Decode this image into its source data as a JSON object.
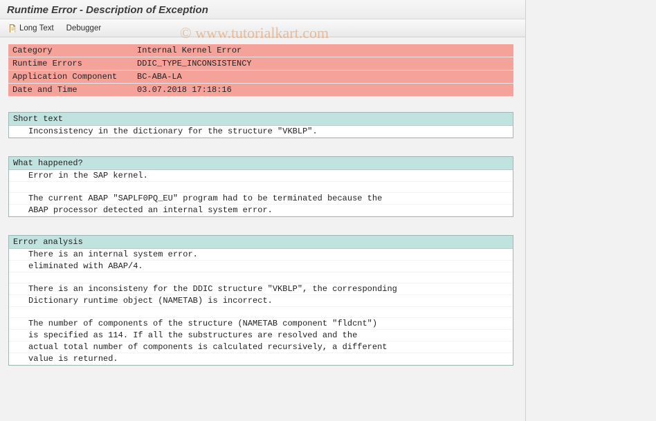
{
  "title": "Runtime Error - Description of Exception",
  "toolbar": {
    "long_text": "Long Text",
    "debugger": "Debugger"
  },
  "summary": [
    {
      "label": "Category",
      "value": "Internal Kernel Error"
    },
    {
      "label": "Runtime Errors",
      "value": "DDIC_TYPE_INCONSISTENCY"
    },
    {
      "label": "Application Component",
      "value": "BC-ABA-LA"
    },
    {
      "label": "Date and Time",
      "value": "03.07.2018 17:18:16"
    }
  ],
  "sections": {
    "short_text": {
      "header": "Short text",
      "lines": [
        "Inconsistency in the dictionary for the structure \"VKBLP\"."
      ]
    },
    "what_happened": {
      "header": "What happened?",
      "lines": [
        "Error in the SAP kernel.",
        "",
        "The current ABAP \"SAPLF0PQ_EU\" program had to be terminated because the",
        "ABAP processor detected an internal system error."
      ]
    },
    "error_analysis": {
      "header": "Error analysis",
      "lines": [
        "There is an internal system error.",
        "eliminated with ABAP/4.",
        "",
        "There is an inconsisteny for the DDIC structure \"VKBLP\", the corresponding",
        "Dictionary runtime object (NAMETAB) is incorrect.",
        "",
        "The number of components of the structure (NAMETAB component \"fldcnt\")",
        "is specified as 114. If all the substructures are resolved and the",
        "actual total number of components is calculated recursively, a different",
        "value is returned."
      ]
    }
  },
  "watermark": "© www.tutorialkart.com"
}
